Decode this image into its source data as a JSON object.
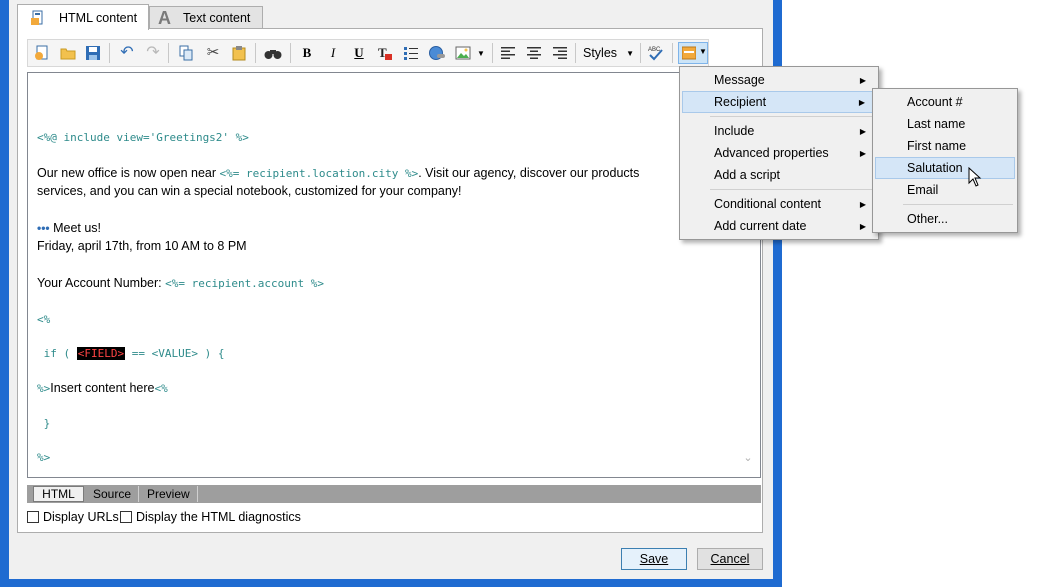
{
  "tabs": [
    {
      "label": "HTML content",
      "icon": "html-page-icon",
      "active": true
    },
    {
      "label": "Text content",
      "icon": "text-a-icon",
      "active": false
    }
  ],
  "toolbar": {
    "styles_label": "Styles",
    "bold": "B",
    "italic": "I",
    "underline": "U",
    "spellcheck": "ABC"
  },
  "editor": {
    "lines": {
      "include": "<%@ include view='Greetings2' %>",
      "p1_a": "Our new office is now open near ",
      "p1_code": "<%= recipient.location.city %>",
      "p1_b": ". Visit our agency, discover our products",
      "p2": "services, and you can win a special notebook, customized for your company!",
      "dots": "•••",
      "meet": " Meet us!",
      "date": "Friday, april 17th, from 10 AM to 8 PM",
      "acct_label": "Your Account Number: ",
      "acct_code": "<%= recipient.account %>",
      "open_tag": "<%",
      "if_a": " if ( ",
      "if_field": "<FIELD>",
      "if_b": " == <VALUE> ) {",
      "close_pre": "%>",
      "insert": "Insert content here",
      "open_post": "<%",
      "brace": " }",
      "close_tag": "%>"
    }
  },
  "bottom_tabs": [
    "HTML",
    "Source",
    "Preview"
  ],
  "checkboxes": [
    {
      "label": "Display URLs",
      "checked": false
    },
    {
      "label": "Display the HTML diagnostics",
      "checked": false
    }
  ],
  "buttons": {
    "save": "Save",
    "cancel": "Cancel"
  },
  "menu": {
    "items": [
      "Message",
      "Recipient",
      "Include",
      "Advanced properties",
      "Add a script",
      "Conditional content",
      "Add current date"
    ]
  },
  "submenu": {
    "items": [
      "Account #",
      "Last name",
      "First name",
      "Salutation",
      "Email",
      "Other..."
    ]
  },
  "colors": {
    "frame": "#1f6bd1",
    "code": "#2e8b8b",
    "highlight": "#d5e6f7"
  }
}
